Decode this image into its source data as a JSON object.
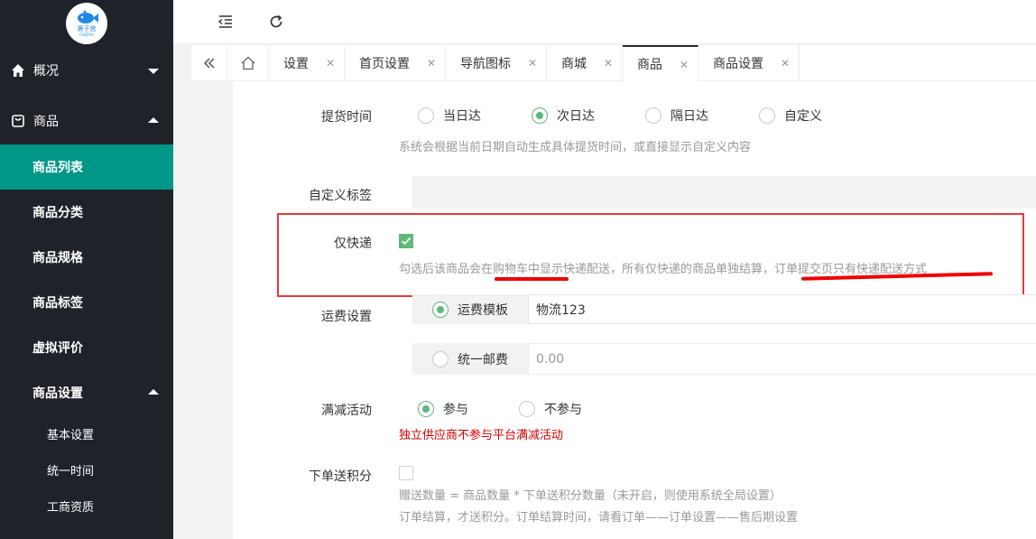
{
  "brand": {
    "logo_text": "第子宫",
    "logo_sub": "CHIZIYU"
  },
  "sidebar": {
    "overview": "概况",
    "goods": "商品",
    "items": [
      "商品列表",
      "商品分类",
      "商品规格",
      "商品标签",
      "虚拟评价"
    ],
    "goods_settings": "商品设置",
    "sub_items": [
      "基本设置",
      "统一时间",
      "工商资质"
    ]
  },
  "tabs": [
    {
      "label": "设置"
    },
    {
      "label": "首页设置"
    },
    {
      "label": "导航图标"
    },
    {
      "label": "商城"
    },
    {
      "label": "商品",
      "active": true
    },
    {
      "label": "商品设置"
    }
  ],
  "form": {
    "pickup": {
      "label": "提货时间",
      "options": [
        "当日达",
        "次日达",
        "隔日达",
        "自定义"
      ],
      "selected": "次日达",
      "hint": "系统会根据当前日期自动生成具体提货时间，或直接显示自定义内容"
    },
    "custom_tag": {
      "label": "自定义标签",
      "value": ""
    },
    "express_only": {
      "label": "仅快递",
      "checked": true,
      "hint": "勾选后该商品会在购物车中显示快递配送，所有仅快递的商品单独结算，订单提交页只有快递配送方式"
    },
    "shipping": {
      "label": "运费设置",
      "template_label": "运费模板",
      "template_value": "物流123",
      "flat_label": "统一邮费",
      "flat_value": "0.00",
      "selected": "运费模板"
    },
    "discount": {
      "label": "满减活动",
      "options": [
        "参与",
        "不参与"
      ],
      "selected": "参与",
      "warn": "独立供应商不参与平台满减活动"
    },
    "points": {
      "label": "下单送积分",
      "checked": false,
      "hint1": "赠送数量 = 商品数量 * 下单送积分数量（未开启，则使用系统全局设置）",
      "hint2": "订单结算，才送积分。订单结算时间，请看订单——订单设置——售后期设置"
    }
  },
  "colors": {
    "accent": "#009688",
    "radio_on": "#5fb878",
    "annotation": "#e43a3a"
  }
}
